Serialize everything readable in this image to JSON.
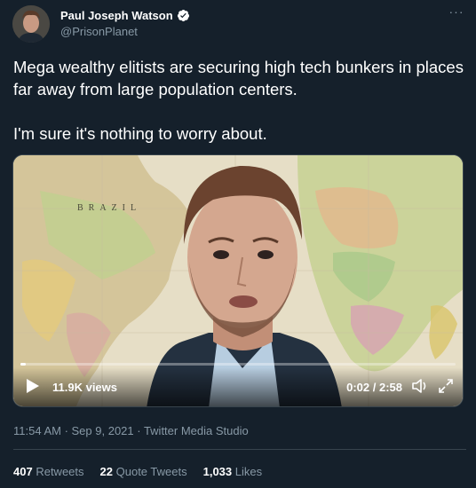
{
  "author": {
    "name": "Paul Joseph Watson",
    "handle": "@PrisonPlanet",
    "verified": true
  },
  "tweet": {
    "paragraph1": "Mega wealthy elitists are securing high tech bunkers in places far away from large population centers.",
    "paragraph2": "I'm sure it's nothing to worry about."
  },
  "video": {
    "map_label": "BRAZIL",
    "views": "11.9K views",
    "time": "0:02 / 2:58",
    "progress_fraction": 0.012
  },
  "meta": {
    "timestamp": "11:54 AM · Sep 9, 2021 · Twitter Media Studio"
  },
  "stats": {
    "retweets_count": "407",
    "retweets_label": "Retweets",
    "quotes_count": "22",
    "quotes_label": "Quote Tweets",
    "likes_count": "1,033",
    "likes_label": "Likes"
  },
  "colors": {
    "background": "#15202b",
    "text_primary": "#ffffff",
    "text_secondary": "#8899a6",
    "verified": "#ffffff"
  }
}
